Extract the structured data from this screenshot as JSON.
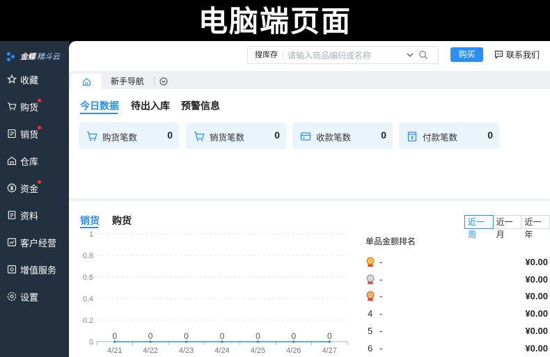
{
  "banner": {
    "title": "电脑端页面"
  },
  "logo": {
    "brand": "金蝶",
    "product": "精斗云"
  },
  "sidebar": {
    "items": [
      {
        "label": "收藏",
        "icon": "star-icon",
        "badge": false
      },
      {
        "label": "购货",
        "icon": "cart-icon",
        "badge": true
      },
      {
        "label": "销货",
        "icon": "receipt-icon",
        "badge": true
      },
      {
        "label": "仓库",
        "icon": "warehouse-icon",
        "badge": false
      },
      {
        "label": "资金",
        "icon": "yen-icon",
        "badge": true
      },
      {
        "label": "资料",
        "icon": "document-icon",
        "badge": false
      },
      {
        "label": "客户经营",
        "icon": "chart-icon",
        "badge": false
      },
      {
        "label": "增值服务",
        "icon": "service-icon",
        "badge": false
      },
      {
        "label": "设置",
        "icon": "gear-icon",
        "badge": false
      }
    ]
  },
  "header": {
    "search_category": "搜库存",
    "search_placeholder": "请输入商品编码或名称",
    "buy_label": "购买",
    "contact_label": "联系我们"
  },
  "tabs": {
    "nav_label": "新手导航"
  },
  "overview": {
    "tabs": [
      "今日数据",
      "待出入库",
      "预警信息"
    ],
    "active_tab": 0,
    "cards": [
      {
        "label": "购货笔数",
        "value": "0",
        "icon": "cart-icon"
      },
      {
        "label": "销货笔数",
        "value": "0",
        "icon": "cart-icon"
      },
      {
        "label": "收款笔数",
        "value": "0",
        "icon": "card-icon"
      },
      {
        "label": "付款笔数",
        "value": "0",
        "icon": "payment-icon"
      }
    ]
  },
  "sales": {
    "tabs": [
      "销货",
      "购货"
    ],
    "active_tab": 0,
    "periods": [
      "近一周",
      "近一月",
      "近一年"
    ],
    "active_period": 0,
    "ranking_title": "单品金额排名",
    "ranking": [
      {
        "rank": "1",
        "medal": "gold",
        "name": "-",
        "amount": "¥0.00"
      },
      {
        "rank": "2",
        "medal": "silver",
        "name": "-",
        "amount": "¥0.00"
      },
      {
        "rank": "3",
        "medal": "bronze",
        "name": "-",
        "amount": "¥0.00"
      },
      {
        "rank": "4",
        "medal": "",
        "name": "-",
        "amount": "¥0.00"
      },
      {
        "rank": "5",
        "medal": "",
        "name": "-",
        "amount": "¥0.00"
      },
      {
        "rank": "6",
        "medal": "",
        "name": "-",
        "amount": "¥0.00"
      }
    ]
  },
  "chart_data": {
    "type": "line",
    "categories": [
      "4/21",
      "4/22",
      "4/23",
      "4/24",
      "4/25",
      "4/26",
      "4/27"
    ],
    "values": [
      0,
      0,
      0,
      0,
      0,
      0,
      0
    ],
    "data_labels": [
      "0",
      "0",
      "0",
      "0",
      "0",
      "0",
      "0"
    ],
    "yticks": [
      "0",
      "0.2",
      "0.4",
      "0.6",
      "0.8",
      "1"
    ],
    "ylim": [
      0,
      1
    ],
    "grid": true,
    "title": "",
    "xlabel": "",
    "ylabel": ""
  },
  "colors": {
    "accent": "#2c8ef8",
    "sidebar": "#233040",
    "badge": "#f5303b",
    "card": "#eaf4fd"
  }
}
